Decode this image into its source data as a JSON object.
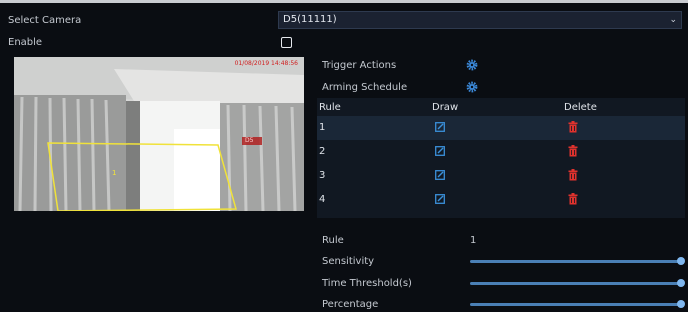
{
  "select_camera": {
    "label": "Select Camera",
    "value": "D5(11111)"
  },
  "enable": {
    "label": "Enable",
    "checked": false
  },
  "video": {
    "timestamp": "01/08/2019 14:48:56",
    "channel_label": "D5"
  },
  "links": {
    "trigger_actions": "Trigger Actions",
    "arming_schedule": "Arming Schedule"
  },
  "rules_table": {
    "headers": {
      "rule": "Rule",
      "draw": "Draw",
      "delete": "Delete"
    },
    "rows": [
      {
        "rule": "1"
      },
      {
        "rule": "2"
      },
      {
        "rule": "3"
      },
      {
        "rule": "4"
      }
    ],
    "selected_row": 1
  },
  "settings": {
    "rule_label": "Rule",
    "rule_value": "1",
    "sensitivity_label": "Sensitivity",
    "sensitivity_level": 1.0,
    "time_threshold_label": "Time Threshold(s)",
    "time_threshold_level": 1.0,
    "percentage_label": "Percentage",
    "percentage_level": 1.0
  },
  "colors": {
    "accent": "#4a7fb5",
    "delete_red": "#e0322d",
    "draw_blue": "#3a8fd9",
    "rule_line": "#f0e23a"
  }
}
